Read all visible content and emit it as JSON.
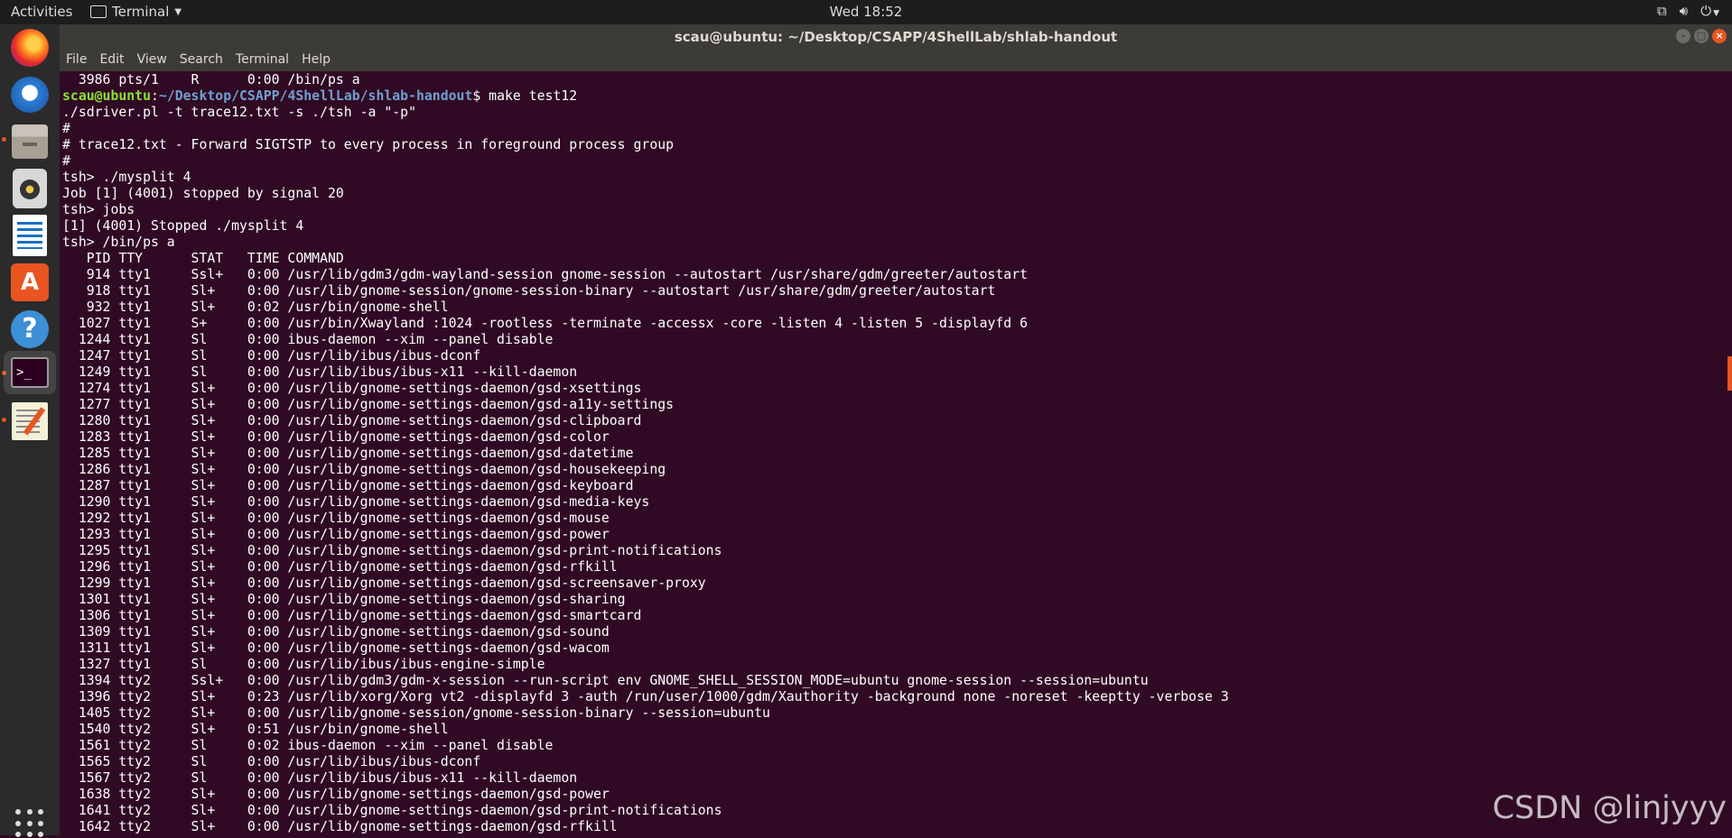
{
  "topbar": {
    "activities": "Activities",
    "app_name": "Terminal",
    "clock": "Wed 18:52"
  },
  "window": {
    "title": "scau@ubuntu: ~/Desktop/CSAPP/4ShellLab/shlab-handout"
  },
  "menu": [
    "File",
    "Edit",
    "View",
    "Search",
    "Terminal",
    "Help"
  ],
  "terminal": {
    "first_line": "  3986 pts/1    R      0:00 /bin/ps a",
    "prompt_user": "scau@ubuntu",
    "prompt_sep": ":",
    "prompt_path": "~/Desktop/CSAPP/4ShellLab/shlab-handout",
    "prompt_cmd": "$ make test12",
    "lines": [
      "./sdriver.pl -t trace12.txt -s ./tsh -a \"-p\"",
      "#",
      "# trace12.txt - Forward SIGTSTP to every process in foreground process group",
      "#",
      "tsh> ./mysplit 4",
      "Job [1] (4001) stopped by signal 20",
      "tsh> jobs",
      "[1] (4001) Stopped ./mysplit 4",
      "tsh> /bin/ps a",
      "   PID TTY      STAT   TIME COMMAND",
      "   914 tty1     Ssl+   0:00 /usr/lib/gdm3/gdm-wayland-session gnome-session --autostart /usr/share/gdm/greeter/autostart",
      "   918 tty1     Sl+    0:00 /usr/lib/gnome-session/gnome-session-binary --autostart /usr/share/gdm/greeter/autostart",
      "   932 tty1     Sl+    0:02 /usr/bin/gnome-shell",
      "  1027 tty1     S+     0:00 /usr/bin/Xwayland :1024 -rootless -terminate -accessx -core -listen 4 -listen 5 -displayfd 6",
      "  1244 tty1     Sl     0:00 ibus-daemon --xim --panel disable",
      "  1247 tty1     Sl     0:00 /usr/lib/ibus/ibus-dconf",
      "  1249 tty1     Sl     0:00 /usr/lib/ibus/ibus-x11 --kill-daemon",
      "  1274 tty1     Sl+    0:00 /usr/lib/gnome-settings-daemon/gsd-xsettings",
      "  1277 tty1     Sl+    0:00 /usr/lib/gnome-settings-daemon/gsd-a11y-settings",
      "  1280 tty1     Sl+    0:00 /usr/lib/gnome-settings-daemon/gsd-clipboard",
      "  1283 tty1     Sl+    0:00 /usr/lib/gnome-settings-daemon/gsd-color",
      "  1285 tty1     Sl+    0:00 /usr/lib/gnome-settings-daemon/gsd-datetime",
      "  1286 tty1     Sl+    0:00 /usr/lib/gnome-settings-daemon/gsd-housekeeping",
      "  1287 tty1     Sl+    0:00 /usr/lib/gnome-settings-daemon/gsd-keyboard",
      "  1290 tty1     Sl+    0:00 /usr/lib/gnome-settings-daemon/gsd-media-keys",
      "  1292 tty1     Sl+    0:00 /usr/lib/gnome-settings-daemon/gsd-mouse",
      "  1293 tty1     Sl+    0:00 /usr/lib/gnome-settings-daemon/gsd-power",
      "  1295 tty1     Sl+    0:00 /usr/lib/gnome-settings-daemon/gsd-print-notifications",
      "  1296 tty1     Sl+    0:00 /usr/lib/gnome-settings-daemon/gsd-rfkill",
      "  1299 tty1     Sl+    0:00 /usr/lib/gnome-settings-daemon/gsd-screensaver-proxy",
      "  1301 tty1     Sl+    0:00 /usr/lib/gnome-settings-daemon/gsd-sharing",
      "  1306 tty1     Sl+    0:00 /usr/lib/gnome-settings-daemon/gsd-smartcard",
      "  1309 tty1     Sl+    0:00 /usr/lib/gnome-settings-daemon/gsd-sound",
      "  1311 tty1     Sl+    0:00 /usr/lib/gnome-settings-daemon/gsd-wacom",
      "  1327 tty1     Sl     0:00 /usr/lib/ibus/ibus-engine-simple",
      "  1394 tty2     Ssl+   0:00 /usr/lib/gdm3/gdm-x-session --run-script env GNOME_SHELL_SESSION_MODE=ubuntu gnome-session --session=ubuntu",
      "  1396 tty2     Sl+    0:23 /usr/lib/xorg/Xorg vt2 -displayfd 3 -auth /run/user/1000/gdm/Xauthority -background none -noreset -keeptty -verbose 3",
      "  1405 tty2     Sl+    0:00 /usr/lib/gnome-session/gnome-session-binary --session=ubuntu",
      "  1540 tty2     Sl+    0:51 /usr/bin/gnome-shell",
      "  1561 tty2     Sl     0:02 ibus-daemon --xim --panel disable",
      "  1565 tty2     Sl     0:00 /usr/lib/ibus/ibus-dconf",
      "  1567 tty2     Sl     0:00 /usr/lib/ibus/ibus-x11 --kill-daemon",
      "  1638 tty2     Sl+    0:00 /usr/lib/gnome-settings-daemon/gsd-power",
      "  1641 tty2     Sl+    0:00 /usr/lib/gnome-settings-daemon/gsd-print-notifications",
      "  1642 tty2     Sl+    0:00 /usr/lib/gnome-settings-daemon/gsd-rfkill"
    ]
  },
  "watermark": "CSDN @linjyyy",
  "colors": {
    "terminal_bg": "#300a24",
    "prompt_user": "#8ae234",
    "prompt_path": "#729fcf",
    "accent": "#e95420"
  },
  "dock_icons": [
    "firefox-icon",
    "thunderbird-icon",
    "files-icon",
    "rhythmbox-icon",
    "libreoffice-writer-icon",
    "software-center-icon",
    "help-icon",
    "terminal-icon",
    "text-editor-icon",
    "show-applications-icon"
  ]
}
